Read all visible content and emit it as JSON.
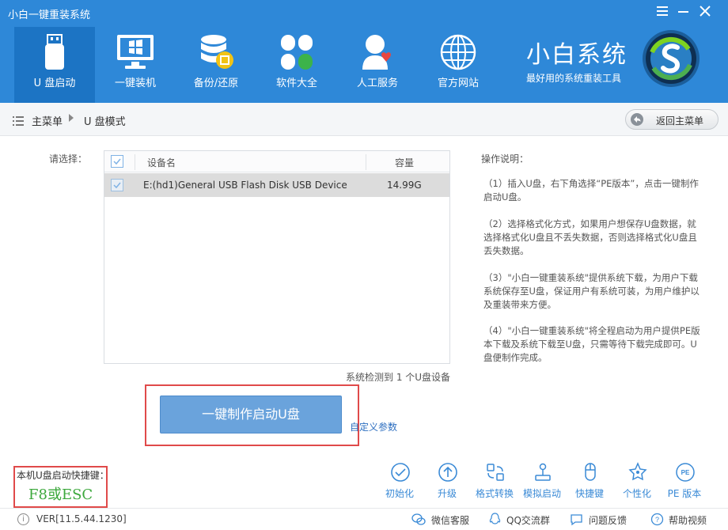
{
  "app": {
    "title": "小白一键重装系统",
    "window_controls": [
      "menu-icon",
      "minimize-icon",
      "close-icon"
    ]
  },
  "nav": [
    {
      "label": "U 盘启动",
      "icon": "usb-drive-icon",
      "active": true
    },
    {
      "label": "一键装机",
      "icon": "monitor-windows-icon",
      "active": false
    },
    {
      "label": "备份/还原",
      "icon": "database-backup-icon",
      "active": false
    },
    {
      "label": "软件大全",
      "icon": "apps-clover-icon",
      "active": false
    },
    {
      "label": "人工服务",
      "icon": "support-person-icon",
      "active": false
    },
    {
      "label": "官方网站",
      "icon": "globe-icon",
      "active": false
    }
  ],
  "brand": {
    "title": "小白系统",
    "subtitle": "最好用的系统重装工具"
  },
  "breadcrumb": {
    "home": "主菜单",
    "current": "U 盘模式",
    "back_label": "返回主菜单"
  },
  "device": {
    "select_label": "请选择：",
    "headers": {
      "name": "设备名",
      "capacity": "容量"
    },
    "rows": [
      {
        "name": "E:(hd1)General USB Flash Disk USB Device",
        "capacity": "14.99G",
        "checked": true,
        "selected": true
      }
    ],
    "detected": "系统检测到 1 个U盘设备"
  },
  "instructions": {
    "title": "操作说明：",
    "steps": [
      "（1）插入U盘，右下角选择“PE版本”，点击一键制作启动U盘。",
      "（2）选择格式化方式，如果用户想保存U盘数据，就选择格式化U盘且不丢失数据，否则选择格式化U盘且丢失数据。",
      "（3）\"小白一键重装系统\"提供系统下载，为用户下载系统保存至U盘，保证用户有系统可装，为用户维护以及重装带来方便。",
      "（4）\"小白一键重装系统\"将全程启动为用户提供PE版本下载及系统下载至U盘，只需等待下载完成即可。U盘便制作完成。"
    ]
  },
  "actions": {
    "make_usb": "一键制作启动U盘",
    "custom_params": "自定义参数"
  },
  "hotkey": {
    "label": "本机U盘启动快捷键：",
    "value": "F8或ESC",
    "value_color": "#3ca83c"
  },
  "tools": [
    {
      "label": "初始化",
      "icon": "check-circle-icon"
    },
    {
      "label": "升级",
      "icon": "upgrade-arrow-icon"
    },
    {
      "label": "格式转换",
      "icon": "format-convert-icon"
    },
    {
      "label": "模拟启动",
      "icon": "joystick-icon"
    },
    {
      "label": "快捷键",
      "icon": "mouse-icon"
    },
    {
      "label": "个性化",
      "icon": "personalize-icon"
    },
    {
      "label": "PE 版本",
      "icon": "pe-badge-icon"
    }
  ],
  "footer": {
    "version": "VER[11.5.44.1230]",
    "links": [
      {
        "label": "微信客服",
        "icon": "wechat-icon"
      },
      {
        "label": "QQ交流群",
        "icon": "qq-icon"
      },
      {
        "label": "问题反馈",
        "icon": "feedback-icon"
      },
      {
        "label": "帮助视频",
        "icon": "help-video-icon"
      }
    ]
  },
  "colors": {
    "header": "#2e88d8",
    "header_active": "#1c74c4",
    "button": "#6aa3dc",
    "link": "#3a8ad6",
    "highlight_box": "#e04a4a"
  }
}
